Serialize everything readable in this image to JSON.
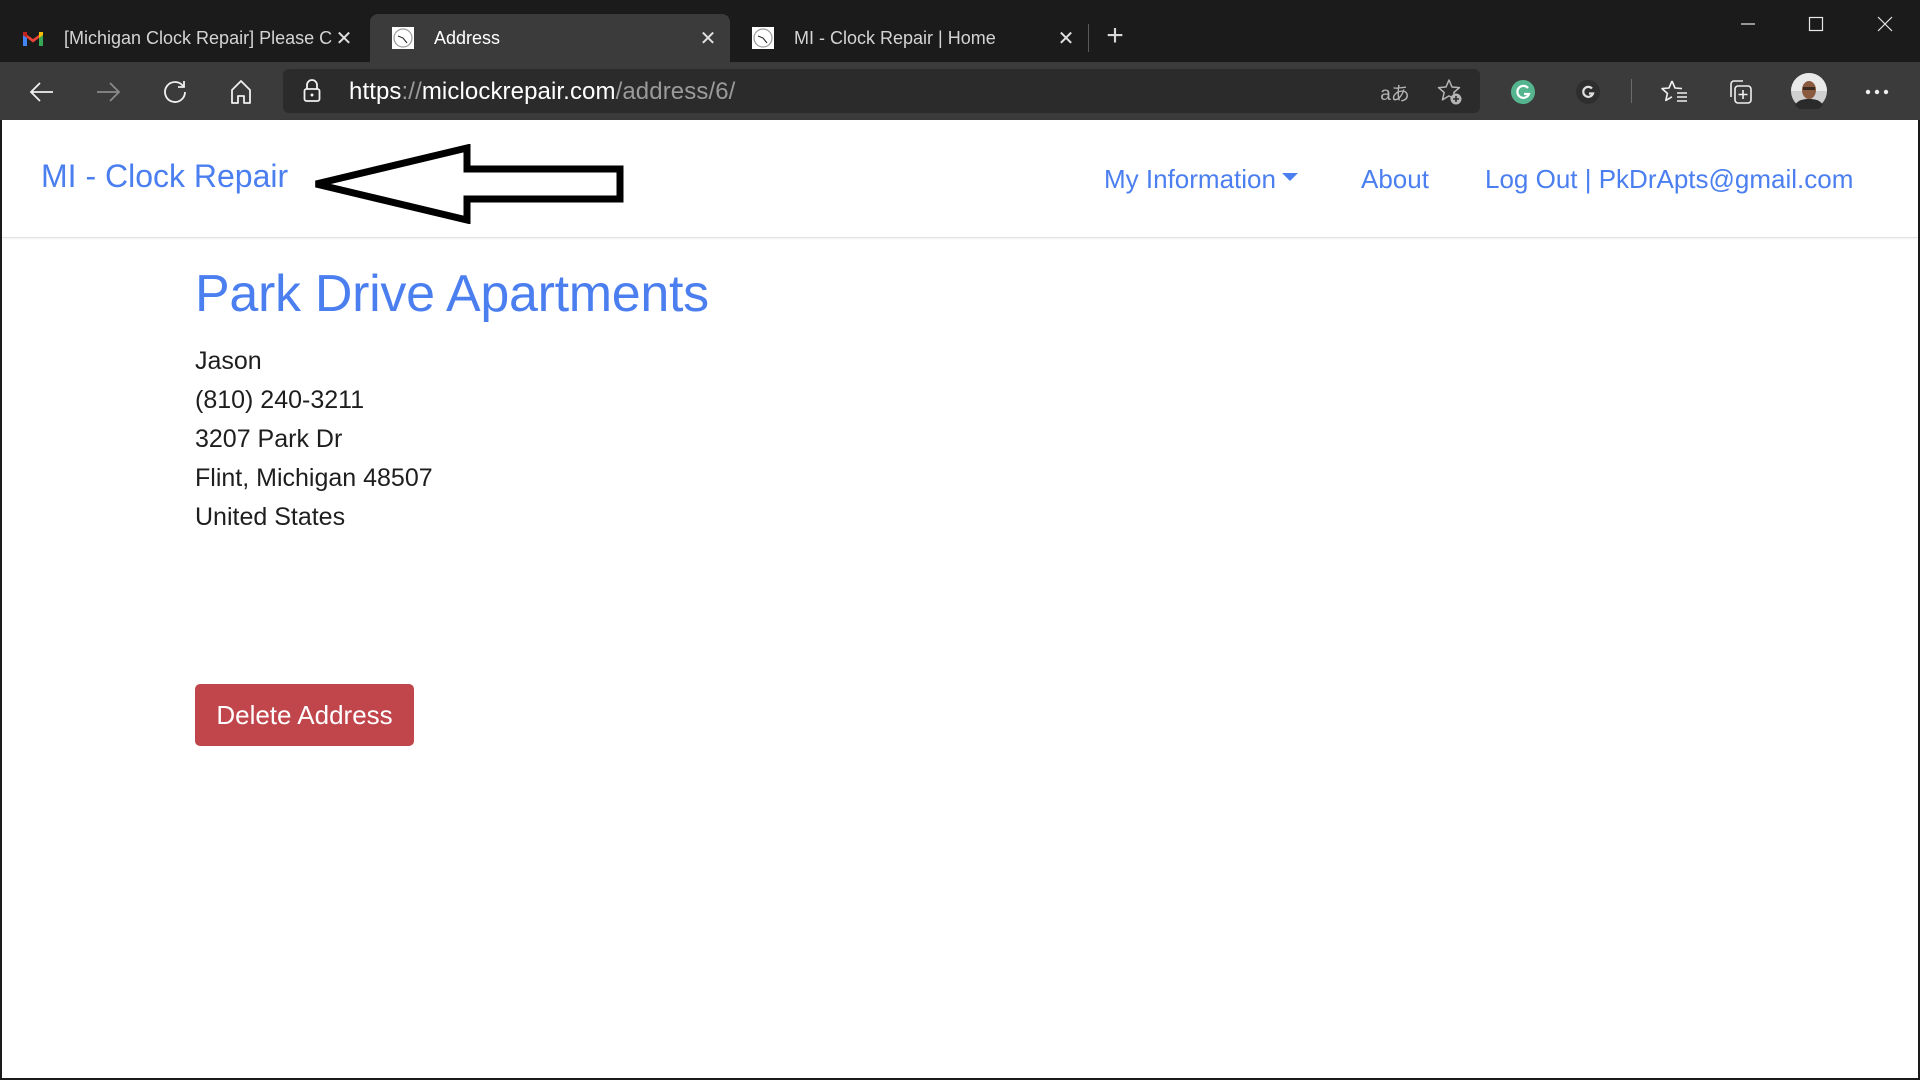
{
  "browser": {
    "tabs": [
      {
        "title": "[Michigan Clock Repair] Please C",
        "icon": "gmail-icon",
        "active": false
      },
      {
        "title": "Address",
        "icon": "clock-favicon-icon",
        "active": true
      },
      {
        "title": "MI - Clock Repair | Home",
        "icon": "clock-favicon-icon",
        "active": false
      }
    ],
    "new_tab_label": "+",
    "url": {
      "scheme": "https",
      "sep": "://",
      "host": "miclockrepair.com",
      "path": "/address/6/"
    },
    "toolbar_icons": [
      "back-icon",
      "forward-icon",
      "refresh-icon",
      "home-icon",
      "lock-icon",
      "read-aloud-translate-icon",
      "add-favorite-icon",
      "grammarly-icon",
      "grammarly-go-icon",
      "favorites-icon",
      "collections-icon",
      "profile-avatar",
      "more-icon"
    ],
    "translate_glyph": "aあ"
  },
  "site": {
    "brand": "MI - Clock Repair",
    "nav": {
      "my_information": "My Information",
      "about": "About",
      "logout": "Log Out | PkDrApts@gmail.com"
    },
    "accent_color": "#4b7ff0"
  },
  "address": {
    "title": "Park Drive Apartments",
    "lines": [
      "Jason",
      "(810) 240-3211",
      "3207 Park Dr",
      "Flint, Michigan 48507",
      "United States"
    ],
    "delete_label": "Delete Address",
    "delete_color": "#c0464c"
  }
}
